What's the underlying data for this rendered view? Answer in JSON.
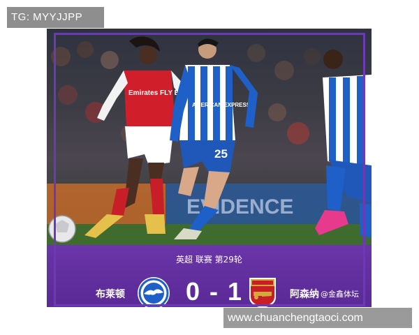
{
  "tag_label": "TG: MYYJJPP",
  "match": {
    "league_line": "英超 联赛 第29轮",
    "home_team": "布莱顿",
    "away_team": "阿森纳",
    "score": "0 - 1",
    "source": "@金鑫体坛"
  },
  "photo": {
    "sponsor_text": "Emirates FLY BETTER",
    "jersey_text": "AMERICAN EXPRESS",
    "player_number": "25",
    "board_text": "EVIDENCE"
  },
  "watermark": "www.chuanchengtaoci.com",
  "colors": {
    "panel": "#5a2a96",
    "frame": "#6d3ab6",
    "arsenal_red": "#d01f2a",
    "brighton_blue": "#1f5fc8"
  }
}
